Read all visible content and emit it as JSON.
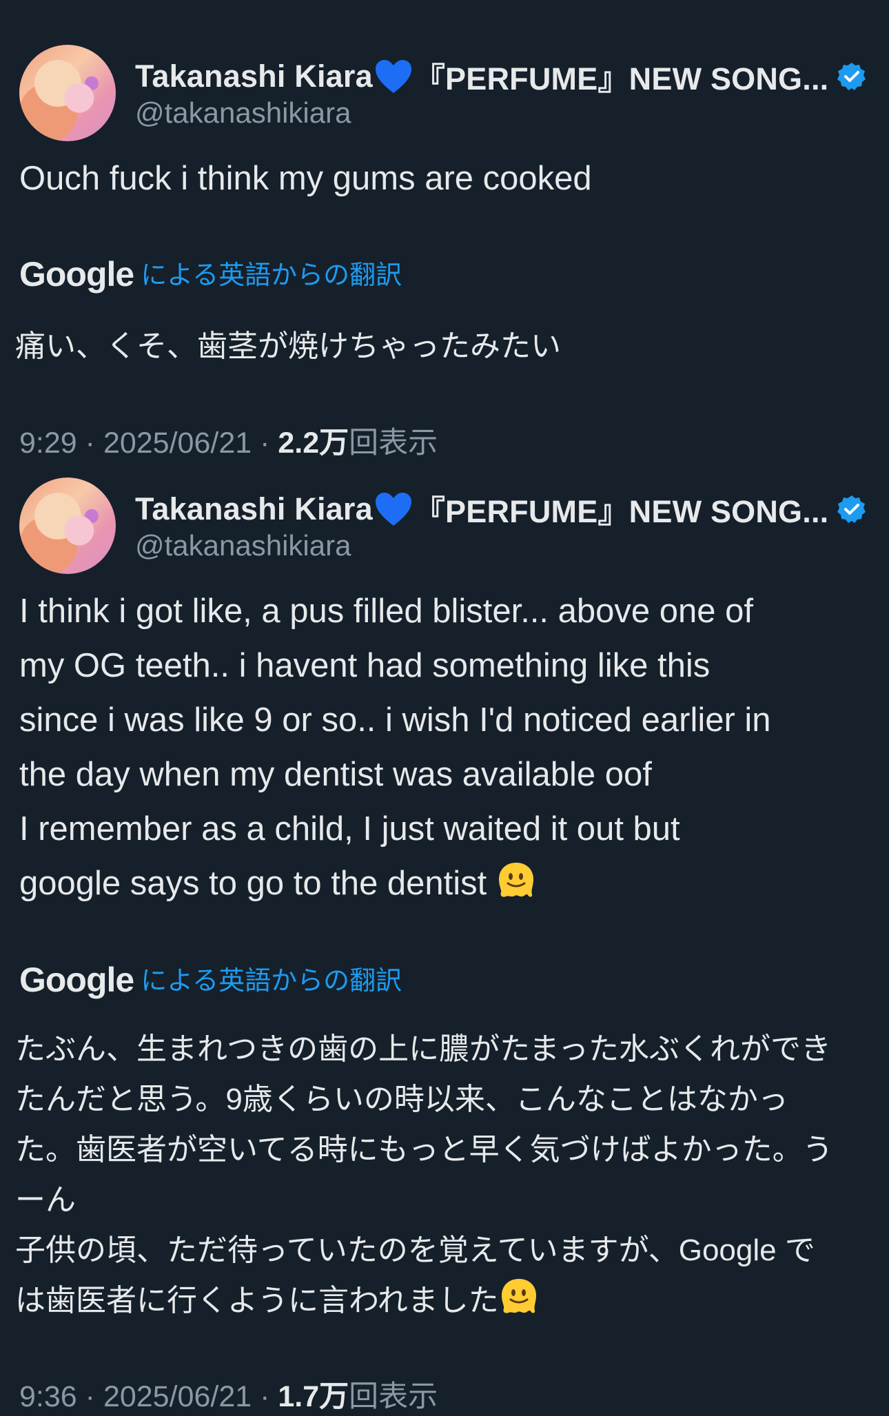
{
  "tweets": [
    {
      "display_name": "Takanashi Kiara",
      "name_suffix": "『PERFUME』NEW SONG...",
      "handle": "@takanashikiara",
      "text": "Ouch fuck i think my gums are cooked",
      "translation_brand": "Google",
      "translation_label": "による英語からの翻訳",
      "translated_text": "痛い、くそ、歯茎が焼けちゃったみたい",
      "time": "9:29",
      "date": "2025/06/21",
      "views_count": "2.2万",
      "views_label": "回表示"
    },
    {
      "display_name": "Takanashi Kiara",
      "name_suffix": "『PERFUME』NEW SONG...",
      "handle": "@takanashikiara",
      "text": "I think i got like, a pus filled blister... above one of\nmy OG teeth.. i havent had something like this\nsince i was like 9 or so.. i wish I'd noticed earlier in\nthe day when my dentist was available oof\nI remember as a child, I just waited it out but\ngoogle says to go to the dentist ",
      "translation_brand": "Google",
      "translation_label": "による英語からの翻訳",
      "translated_text": "たぶん、生まれつきの歯の上に膿がたまった水ぶくれができ\nたんだと思う。9歳くらいの時以来、こんなことはなかっ\nた。歯医者が空いてる時にもっと早く気づけばよかった。う\nーん\n子供の頃、ただ待っていたのを覚えていますが、Google で\nは歯医者に行くように言われました",
      "time": "9:36",
      "date": "2025/06/21",
      "views_count": "1.7万",
      "views_label": "回表示"
    }
  ],
  "icons": {
    "heart": "blue-heart-emoji",
    "verified": "verified-badge",
    "emoji": "melting-face-emoji"
  },
  "colors": {
    "background": "#15202b",
    "text": "#e7e9ea",
    "secondary": "#8b98a5",
    "accent": "#1d9bf0",
    "heart": "#1d6ef5"
  }
}
